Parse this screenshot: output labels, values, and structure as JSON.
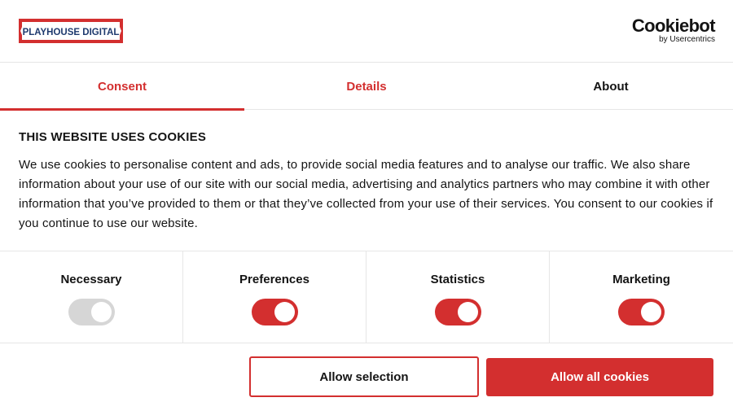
{
  "header": {
    "logo_text": "PLAYHOUSE DIGITAL",
    "cookiebot_text": "Cookiebot",
    "cookiebot_sub": "by Usercentrics"
  },
  "tabs": [
    {
      "label": "Consent",
      "active": true
    },
    {
      "label": "Details",
      "active": false
    },
    {
      "label": "About",
      "active": false
    }
  ],
  "content": {
    "title": "THIS WEBSITE USES COOKIES",
    "description": "We use cookies to personalise content and ads, to provide social media features and to analyse our traffic. We also share information about your use of our site with our social media, advertising and analytics partners who may combine it with other information that you’ve provided to them or that they’ve collected from your use of their services. You consent to our cookies if you continue to use our website."
  },
  "categories": [
    {
      "label": "Necessary",
      "enabled": true,
      "locked": true
    },
    {
      "label": "Preferences",
      "enabled": true,
      "locked": false
    },
    {
      "label": "Statistics",
      "enabled": true,
      "locked": false
    },
    {
      "label": "Marketing",
      "enabled": true,
      "locked": false
    }
  ],
  "buttons": {
    "allow_selection": "Allow selection",
    "allow_all": "Allow all cookies"
  },
  "colors": {
    "accent": "#d32f2f",
    "toggle_disabled": "#d6d6d6",
    "divider": "#e6e6e6",
    "logo_navy": "#1e3a6e"
  }
}
